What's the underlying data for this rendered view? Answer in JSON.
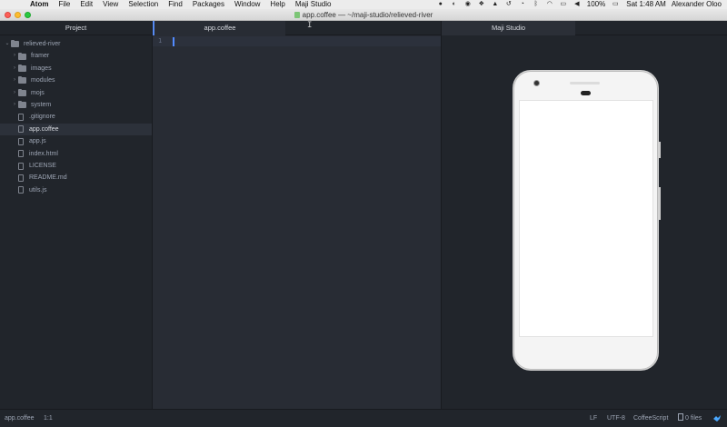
{
  "menubar": {
    "apple_glyph": "",
    "app_name": "Atom",
    "items": [
      "File",
      "Edit",
      "View",
      "Selection",
      "Find",
      "Packages",
      "Window",
      "Help",
      "Maji Studio"
    ],
    "battery": "100%",
    "time": "Sat 1:48 AM",
    "user": "Alexander Oloo"
  },
  "window": {
    "title": "app.coffee — ~/maji-studio/relieved-river"
  },
  "tree": {
    "header": "Project",
    "root": "relieved-river",
    "folders": [
      "framer",
      "images",
      "modules",
      "mojs",
      "system"
    ],
    "files": [
      ".gitignore",
      "app.coffee",
      "app.js",
      "index.html",
      "LICENSE",
      "README.md",
      "utils.js"
    ],
    "selected": "app.coffee"
  },
  "editor": {
    "tab_label": "app.coffee",
    "line_number": "1",
    "ibeam_glyph": "I"
  },
  "preview": {
    "tab_label": "Maji Studio"
  },
  "statusbar": {
    "file": "app.coffee",
    "cursor": "1:1",
    "line_ending": "LF",
    "encoding": "UTF-8",
    "grammar": "CoffeeScript",
    "files_count": "0 files"
  },
  "colors": {
    "accent": "#568af2",
    "background": "#21252b",
    "editor": "#282c34"
  }
}
